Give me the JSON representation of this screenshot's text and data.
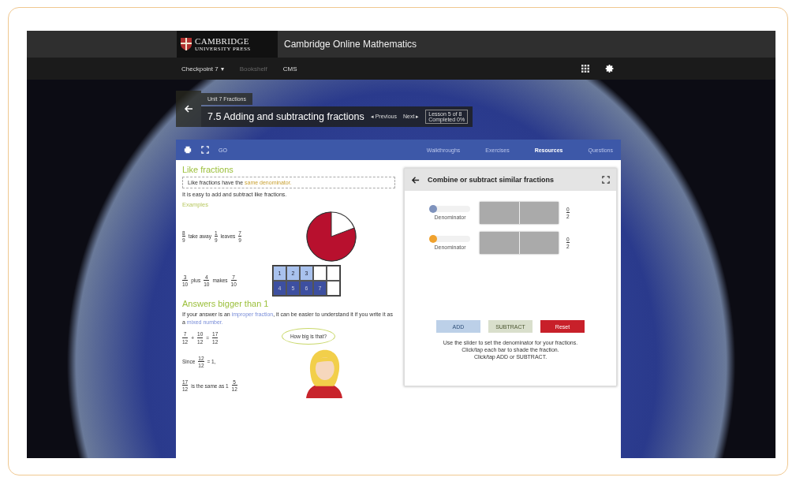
{
  "header": {
    "logo_top": "CAMBRIDGE",
    "logo_bottom": "UNIVERSITY PRESS",
    "title": "Cambridge Online Mathematics"
  },
  "nav": [
    {
      "label": "Checkpoint 7",
      "caret": "▾",
      "disabled": false
    },
    {
      "label": "Bookshelf",
      "disabled": true
    },
    {
      "label": "CMS",
      "disabled": false
    }
  ],
  "breadcrumb": {
    "unit": "Unit 7 Fractions",
    "title": "7.5 Adding and subtracting fractions",
    "prev": "◂ Previous",
    "next": "Next ▸",
    "progress": [
      "Lesson 5 of 8",
      "Completed 0%"
    ]
  },
  "toolbar": {
    "go": "GO",
    "tabs": [
      {
        "label": "Walkthroughs",
        "selected": false
      },
      {
        "label": "Exercises",
        "selected": false
      },
      {
        "label": "Resources",
        "selected": true
      },
      {
        "label": "Questions",
        "selected": false
      }
    ]
  },
  "lesson": {
    "heading": "Like fractions",
    "definition": {
      "text": "Like fractions have the",
      "term": "same denominator."
    },
    "intro": "It is easy to add and subtract like fractions.",
    "examples_label": "Examples",
    "example1": [
      {
        "kind": "frac",
        "num": "8",
        "den": "9"
      },
      {
        "kind": "word",
        "text": "take away"
      },
      {
        "kind": "frac",
        "num": "1",
        "den": "9"
      },
      {
        "kind": "word",
        "text": "leaves"
      },
      {
        "kind": "frac",
        "num": "7",
        "den": "9"
      }
    ],
    "example2": [
      {
        "kind": "frac",
        "num": "3",
        "den": "10"
      },
      {
        "kind": "word",
        "text": "plus"
      },
      {
        "kind": "frac",
        "num": "4",
        "den": "10"
      },
      {
        "kind": "word",
        "text": "makes"
      },
      {
        "kind": "frac",
        "num": "7",
        "den": "10"
      }
    ],
    "grid": [
      {
        "kind": "light",
        "label": "1"
      },
      {
        "kind": "light",
        "label": "2"
      },
      {
        "kind": "light",
        "label": "3"
      },
      {
        "kind": "empty"
      },
      {
        "kind": "empty"
      },
      {
        "kind": "dark",
        "label": "4"
      },
      {
        "kind": "dark",
        "label": "5"
      },
      {
        "kind": "dark",
        "label": "6"
      },
      {
        "kind": "dark",
        "label": "7"
      },
      {
        "kind": "empty"
      }
    ],
    "heading2": "Answers bigger than 1",
    "para": {
      "before": "If your answer is an",
      "term1": "improper fraction",
      "middle": ", it can be easier to understand it if you write it as a",
      "term2": "mixed number."
    },
    "equation": [
      {
        "kind": "frac",
        "num": "7",
        "den": "12"
      },
      {
        "kind": "word",
        "text": "+"
      },
      {
        "kind": "frac",
        "num": "10",
        "den": "12"
      },
      {
        "kind": "word",
        "text": "="
      },
      {
        "kind": "frac",
        "num": "17",
        "den": "12"
      }
    ],
    "since": [
      {
        "kind": "word",
        "text": "Since"
      },
      {
        "kind": "frac",
        "num": "12",
        "den": "12"
      },
      {
        "kind": "word",
        "text": "= 1,"
      }
    ],
    "same": [
      {
        "kind": "frac",
        "num": "17",
        "den": "12"
      },
      {
        "kind": "word",
        "text": "is the same as 1"
      },
      {
        "kind": "frac",
        "num": "5",
        "den": "12"
      }
    ],
    "bubble": "How big is that?"
  },
  "widget": {
    "title": "Combine or subtract similar fractions",
    "rows": [
      {
        "color": "#7f93bd",
        "level": 0,
        "label": "Denominator",
        "num": "0",
        "den": "2"
      },
      {
        "color": "#f0a22e",
        "level": 0,
        "label": "Denominator",
        "num": "0",
        "den": "2"
      }
    ],
    "buttons": [
      {
        "label": "ADD",
        "kind": "add",
        "disabled": true
      },
      {
        "label": "SUBTRACT",
        "kind": "subtract",
        "disabled": true
      },
      {
        "label": "Reset",
        "kind": "reset",
        "disabled": false
      }
    ],
    "help": [
      "Use the slider to set the denominator for your fractions.",
      "Click/tap each bar to shade the fraction.",
      "Click/tap ADD or SUBTRACT."
    ]
  }
}
